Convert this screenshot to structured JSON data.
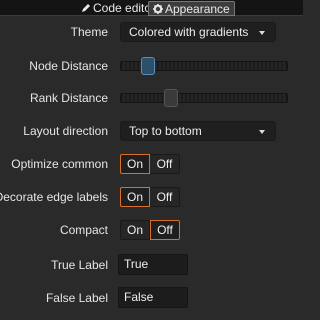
{
  "tabs": [
    {
      "label": "Code editor",
      "icon": "pencil-icon"
    },
    {
      "label": "Appearance",
      "icon": "gear-icon",
      "active": true
    }
  ],
  "settings": {
    "theme": {
      "label": "Theme",
      "value": "Colored with gradients"
    },
    "node_distance": {
      "label": "Node Distance",
      "level": 0.15
    },
    "rank_distance": {
      "label": "Rank Distance",
      "level": 0.3
    },
    "layout_direction": {
      "label": "Layout direction",
      "value": "Top to bottom"
    },
    "optimize_common": {
      "label": "Optimize common",
      "on": "On",
      "off": "Off",
      "selected": "On"
    },
    "decorate_edge_labels": {
      "label": "Decorate edge labels",
      "on": "On",
      "off": "Off",
      "selected": "On"
    },
    "compact": {
      "label": "Compact",
      "on": "On",
      "off": "Off",
      "selected": "Off"
    },
    "true_label": {
      "label": "True Label",
      "value": "True"
    },
    "false_label": {
      "label": "False Label",
      "value": "False"
    }
  },
  "colors": {
    "accent": "#d9702a",
    "slider_active": "#2e4f6a",
    "background": "#2a2a2a"
  }
}
